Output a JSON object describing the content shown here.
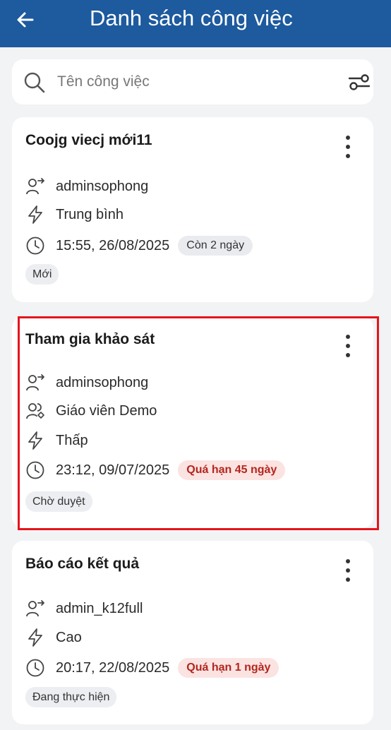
{
  "header": {
    "title": "Danh sách công việc",
    "back_icon": "arrow-left-icon"
  },
  "search": {
    "placeholder": "Tên công việc",
    "value": "",
    "icon": "search-icon",
    "filter_icon": "filter-sliders-icon"
  },
  "colors": {
    "header_bg": "#1d5a9e",
    "overdue_text": "#b3261e",
    "overdue_bg": "#fbe3e1",
    "highlight_border": "#e6141b"
  },
  "tasks": [
    {
      "title": "Coojg viecj mới11",
      "assigner": "adminsophong",
      "priority": "Trung bình",
      "deadline": "15:55, 26/08/2025",
      "deadline_badge": "Còn 2 ngày",
      "status": "Mới"
    },
    {
      "title": "Tham gia khảo sát",
      "assigner": "adminsophong",
      "assignee": "Giáo viên Demo",
      "priority": "Thấp",
      "deadline": "23:12, 09/07/2025",
      "deadline_badge": "Quá hạn 45 ngày",
      "status": "Chờ duyệt"
    },
    {
      "title": "Báo cáo kết quả",
      "assigner": "admin_k12full",
      "priority": "Cao",
      "deadline": "20:17, 22/08/2025",
      "deadline_badge": "Quá hạn 1 ngày",
      "status": "Đang thực hiện"
    }
  ]
}
